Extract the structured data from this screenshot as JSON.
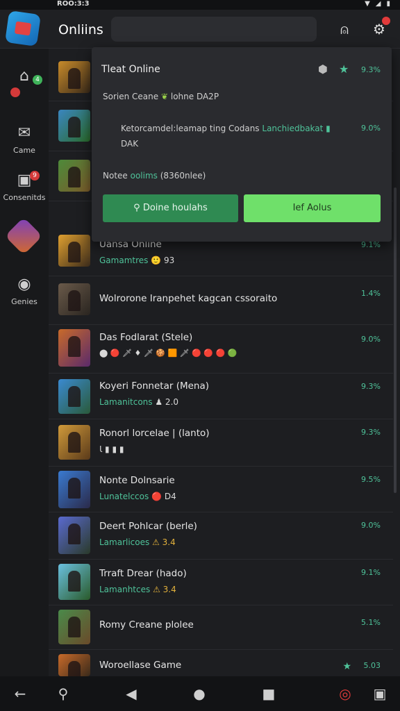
{
  "status_bar": {
    "time": "ROO:3:3",
    "icons": [
      "wifi-icon",
      "signal-icon",
      "battery-icon"
    ]
  },
  "header": {
    "title": "Onliins"
  },
  "sidebar": {
    "items": [
      {
        "label": "",
        "icon": "home-icon",
        "badge": "4"
      },
      {
        "label": "Came",
        "icon": "mail-icon"
      },
      {
        "label": "Consenitds",
        "icon": "gamepad-icon",
        "badge": "9"
      },
      {
        "label": "",
        "icon": "avatar"
      },
      {
        "label": "Genies",
        "icon": "controller-icon"
      }
    ]
  },
  "popup": {
    "title": "Tleat Online",
    "pct": "9.3%",
    "line1_a": "Sorien Ceane",
    "line1_b": "lohne DA2P",
    "line2_a": "Ketorcamdel:leamap ting Codans",
    "line2_b": "Lanchiedbakat",
    "line2_c": "DAK",
    "line2_pct": "9.0%",
    "notes_a": "Notee",
    "notes_b": "oolims",
    "notes_c": "(8360nlee)",
    "btn_primary": "Doine houlahs",
    "btn_secondary": "Ief Aolus"
  },
  "list": {
    "rows": [
      {
        "title": "",
        "sub_g": "",
        "sub_w": "",
        "pct": "",
        "colors": [
          "#c78a2a",
          "#3a2a1a"
        ]
      },
      {
        "title": "",
        "sub_g": "",
        "sub_w": "",
        "pct": "",
        "colors": [
          "#3a86c0",
          "#2a6a2a"
        ]
      },
      {
        "title": "",
        "sub_g": "",
        "sub_w": "",
        "pct": "",
        "colors": [
          "#4d8a3a",
          "#7a5a2a"
        ]
      },
      {
        "title": "Uansa Online",
        "sub_g": "Gamamtres",
        "sub_w": "🙂 93",
        "pct": "9.1%",
        "colors": [
          "#e0a030",
          "#3a2a1a"
        ]
      },
      {
        "title": "Wolrorone Iranpehet kagcan cssoraito",
        "sub_g": "",
        "sub_w": "",
        "pct": "1.4%",
        "colors": [
          "#6a5a4a",
          "#2a2520"
        ]
      },
      {
        "title": "Das Fodlarat (Stele)",
        "sub_g": "",
        "sub_w": "⬤ 🔴 🗡 ♦ 🗡 🍪 🟧 🗡 🔴 🔴 🔴 🟢",
        "pct": "9.0%",
        "colors": [
          "#c86a2a",
          "#5a2a6a"
        ]
      },
      {
        "title": "Koyeri Fonnetar (Mena)",
        "sub_g": "Lamanitcons",
        "sub_w": "♟ 2.0",
        "pct": "9.3%",
        "colors": [
          "#3a8ad0",
          "#2a5a3a"
        ]
      },
      {
        "title": "Ronorl lorcelae | (lanto)",
        "sub_g": "",
        "sub_w": "Ꙇ ▮ ▮ ▮",
        "pct": "9.3%",
        "colors": [
          "#d09a3a",
          "#5a3a1a"
        ]
      },
      {
        "title": "Nonte Dolnsarie",
        "sub_g": "Lunatelccos",
        "sub_w": "🔴 D4",
        "pct": "9.5%",
        "colors": [
          "#3a7ad0",
          "#2a2a4a"
        ]
      },
      {
        "title": "Deert Pohlcar (berle)",
        "sub_g": "Lamarlicoes",
        "sub_w": "⚠ 3.4",
        "pct": "9.0%",
        "colors": [
          "#5a6ad0",
          "#2a3a2a"
        ]
      },
      {
        "title": "Trraft Drear (hado)",
        "sub_g": "Lamanhtces",
        "sub_w": "⚠ 3.4",
        "pct": "9.1%",
        "colors": [
          "#6ac0e0",
          "#2a5a2a"
        ]
      },
      {
        "title": "Romy Creane plolee",
        "sub_g": "",
        "sub_w": "",
        "pct": "5.1%",
        "colors": [
          "#4a8a4a",
          "#6a4a2a"
        ]
      },
      {
        "title": "Woroellase Game",
        "sub_g": "",
        "sub_w": "",
        "pct": "5.03",
        "colors": [
          "#c86a2a",
          "#3a2a1a"
        ]
      }
    ]
  },
  "nav": {
    "icons": [
      "back-icon",
      "search-icon",
      "triangle-back-icon",
      "home-circle-icon",
      "recents-square-icon",
      "record-icon",
      "profile-icon"
    ]
  }
}
